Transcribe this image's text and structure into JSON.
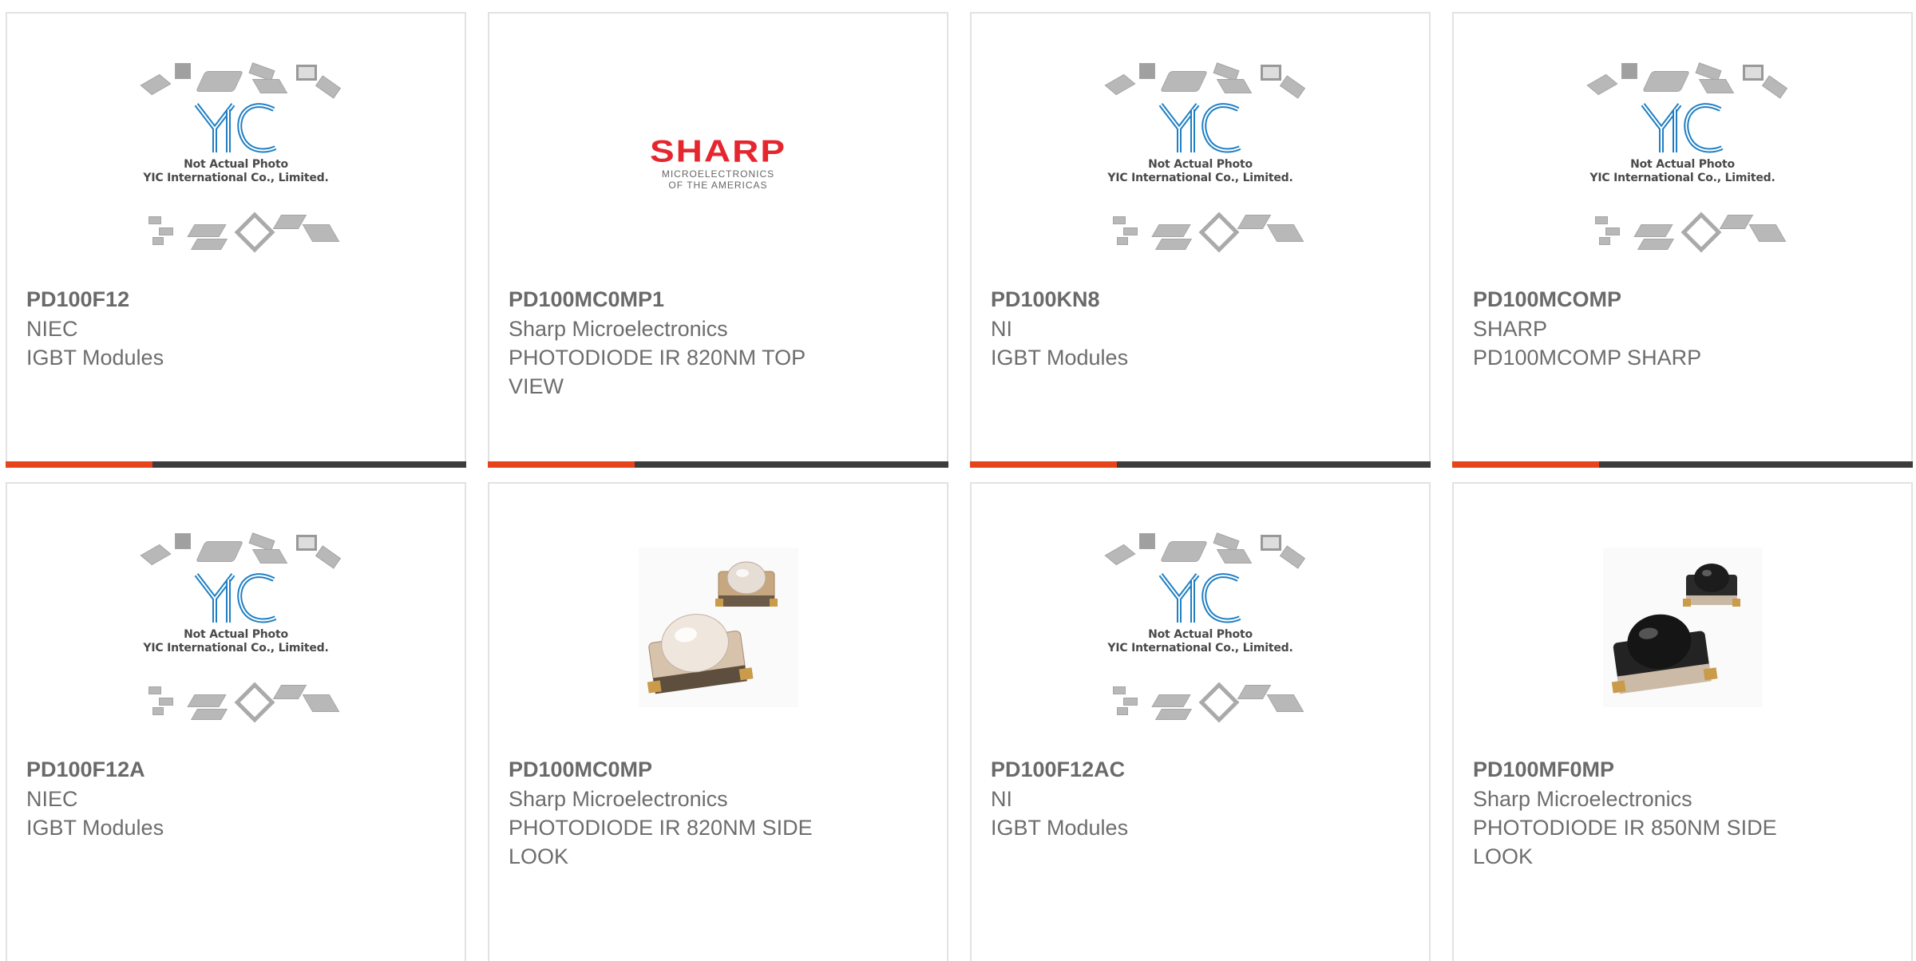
{
  "products": [
    {
      "part": "PD100F12",
      "manufacturer": "NIEC",
      "description": "IGBT Modules",
      "image": "placeholder"
    },
    {
      "part": "PD100MC0MP1",
      "manufacturer": "Sharp Microelectronics",
      "description": "PHOTODIODE IR 820NM TOP VIEW",
      "image": "sharp-logo"
    },
    {
      "part": "PD100KN8",
      "manufacturer": "NI",
      "description": "IGBT Modules",
      "image": "placeholder"
    },
    {
      "part": "PD100MCOMP",
      "manufacturer": "SHARP",
      "description": "PD100MCOMP SHARP",
      "image": "placeholder"
    },
    {
      "part": "PD100F12A",
      "manufacturer": "NIEC",
      "description": "IGBT Modules",
      "image": "placeholder"
    },
    {
      "part": "PD100MC0MP",
      "manufacturer": "Sharp Microelectronics",
      "description": "PHOTODIODE IR 820NM SIDE LOOK",
      "image": "photodiode-clear"
    },
    {
      "part": "PD100F12AC",
      "manufacturer": "NI",
      "description": "IGBT Modules",
      "image": "placeholder"
    },
    {
      "part": "PD100MF0MP",
      "manufacturer": "Sharp Microelectronics",
      "description": "PHOTODIODE IR 850NM SIDE LOOK",
      "image": "photodiode-black"
    }
  ],
  "placeholder": {
    "logo_text": "YIC",
    "caption_line1": "Not Actual Photo",
    "caption_line2": "YIC International Co., Limited."
  },
  "sharp_logo": {
    "word": "SHARP",
    "sub_line1": "MICROELECTRONICS",
    "sub_line2": "OF THE AMERICAS"
  },
  "colors": {
    "accent": "#e8441b",
    "bar": "#3c3c3c",
    "yic_blue": "#1f7fc4",
    "sharp_red": "#e5262e"
  }
}
